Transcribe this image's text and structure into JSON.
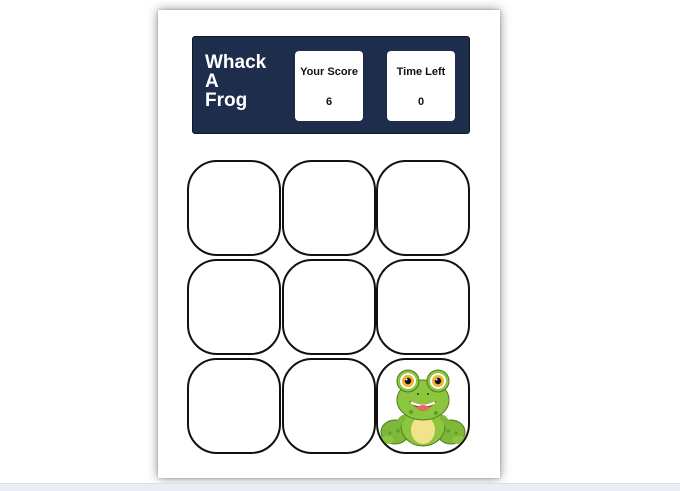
{
  "game": {
    "title_lines": [
      "Whack",
      "A",
      "Frog"
    ]
  },
  "scoreboard": {
    "score_label": "Your Score",
    "score_value": "6",
    "time_label": "Time Left",
    "time_value": "0"
  },
  "board": {
    "rows": 3,
    "cols": 3,
    "frog_cell": 8
  },
  "colors": {
    "header_bg": "#1f2d4d",
    "frog_green": "#8cc63f",
    "frog_belly": "#f2e28a",
    "hole_border": "#111111"
  }
}
